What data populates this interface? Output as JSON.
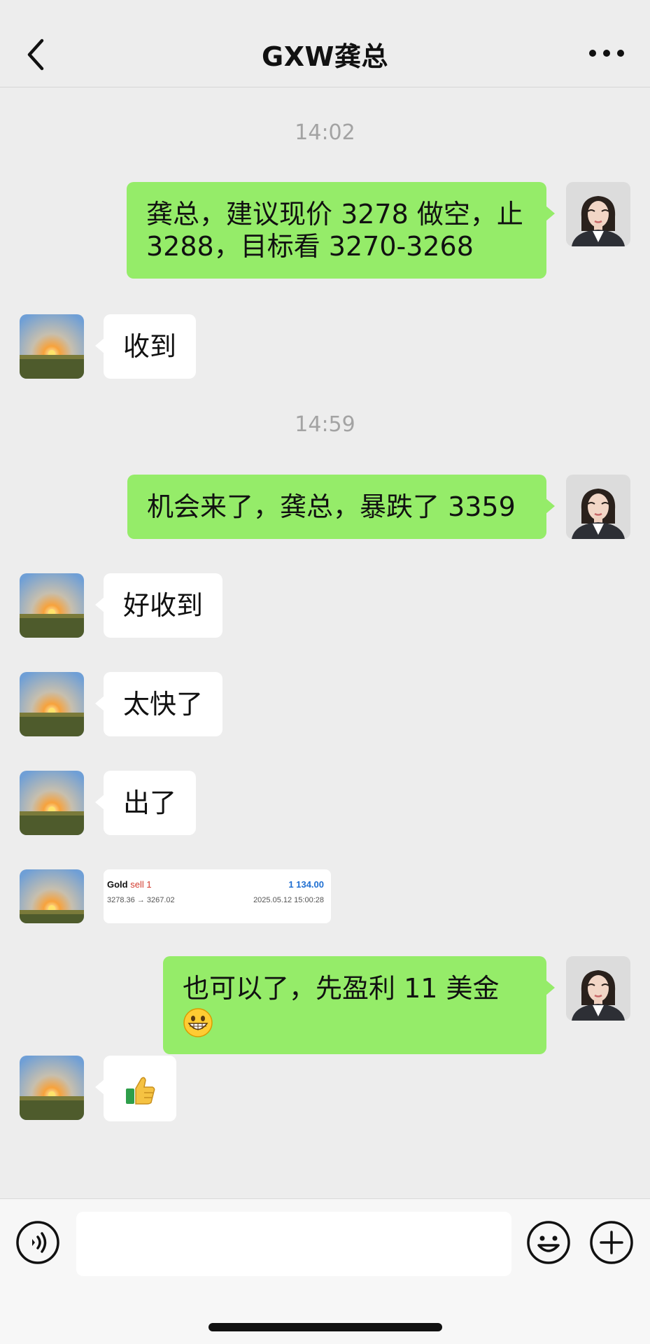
{
  "header": {
    "title": "GXW龚总"
  },
  "messages": {
    "ts1": "14:02",
    "m1": "龚总，建议现价 3278 做空，止",
    "m1b": "3288，目标看 3270-3268",
    "m2": "收到",
    "ts2": "14:59",
    "m3": "机会来了，龚总，暴跌了 3359",
    "m4": "好收到",
    "m5": "太快了",
    "m6": "出了",
    "m8": "也可以了，先盈利 11 美金"
  },
  "trade_card": {
    "symbol": "Gold",
    "side": "sell 1",
    "profit": "1 134.00",
    "prices": "3278.36 → 3267.02",
    "time": "2025.05.12 15:00:28"
  },
  "icons": {
    "m8_emoji": "grinning-face-icon",
    "m9_emoji": "thumbs-up-icon"
  },
  "input": {
    "placeholder": ""
  }
}
